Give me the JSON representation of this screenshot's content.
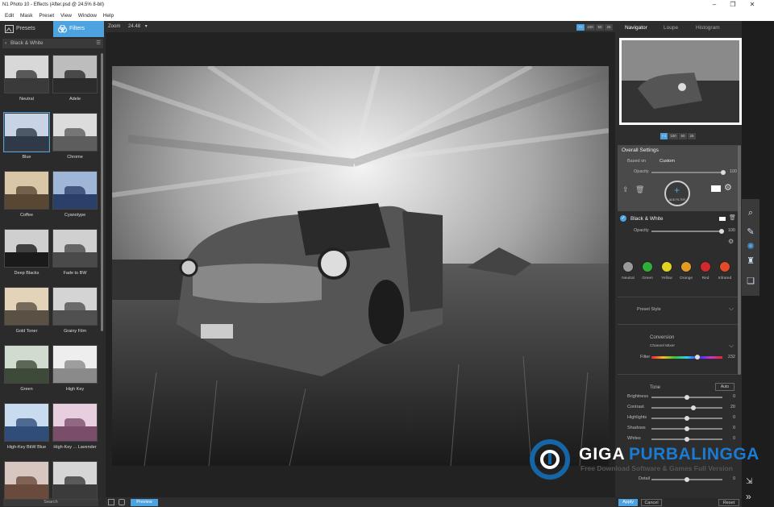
{
  "window": {
    "title": "N1 Photo 10 - Effects (After.psd @ 24.5% 8-bit)",
    "min": "–",
    "max": "❐",
    "close": "✕"
  },
  "menu": [
    "Edit",
    "Mask",
    "Preset",
    "View",
    "Window",
    "Help"
  ],
  "left": {
    "tab_presets": "Presets",
    "tab_filters": "Filters",
    "category": "Black & White",
    "presets": [
      "Neutral",
      "Adele",
      "Blue",
      "Chrome",
      "Coffee",
      "Cyanotype",
      "Deep Blacks",
      "Fade to BW",
      "Gold Toner",
      "Grainy Film",
      "Green",
      "High Key",
      "High-Key BkW Blue",
      "High-Key ... Lavender",
      "",
      ""
    ],
    "search": "Search"
  },
  "canvas": {
    "zoom_label": "Zoom",
    "zoom_value": "24.48",
    "zoom_btns": [
      "Fit",
      "100",
      "50",
      "25"
    ],
    "preview": "Preview"
  },
  "right": {
    "tabs": [
      "Navigator",
      "Loupe",
      "Histogram"
    ],
    "nav_zoom": [
      "Fit",
      "100",
      "50",
      "25"
    ],
    "overall": {
      "title": "Overall Settings",
      "based_on_label": "Based on",
      "based_on": "Custom",
      "opacity_label": "Opacity",
      "opacity": "100",
      "add_filter": "ADD FILTER"
    },
    "bw": {
      "title": "Black & White",
      "opacity_label": "Opacity",
      "opacity": "100",
      "colors": [
        {
          "name": "Neutral",
          "color": "#9a9a9a"
        },
        {
          "name": "Green",
          "color": "#2fae3a"
        },
        {
          "name": "Yellow",
          "color": "#e0d21f"
        },
        {
          "name": "Orange",
          "color": "#e39a25"
        },
        {
          "name": "Red",
          "color": "#d22a2a"
        },
        {
          "name": "Infrared",
          "color": "#e24a2a"
        }
      ],
      "preset_style": "Preset Style",
      "conversion_label": "Conversion",
      "conversion_value": "Channel Mixer",
      "filter_label": "Filter",
      "filter_value": "232",
      "tone_label": "Tone",
      "auto": "Auto",
      "sliders": [
        {
          "label": "Brightness",
          "value": "0",
          "pos": 0.5
        },
        {
          "label": "Contrast",
          "value": "20",
          "pos": 0.6
        },
        {
          "label": "Highlights",
          "value": "0",
          "pos": 0.5
        },
        {
          "label": "Shadows",
          "value": "0",
          "pos": 0.5
        },
        {
          "label": "Whites",
          "value": "0",
          "pos": 0.5
        }
      ],
      "detail_label": "Detail",
      "detail_value": "0"
    },
    "apply": "Apply",
    "cancel": "Cancel",
    "reset": "Reset"
  },
  "watermark": {
    "line1a": "GIGA",
    "line1b": "PURBALINGGA",
    "line2": "Free Download Software & Games Full Version"
  }
}
